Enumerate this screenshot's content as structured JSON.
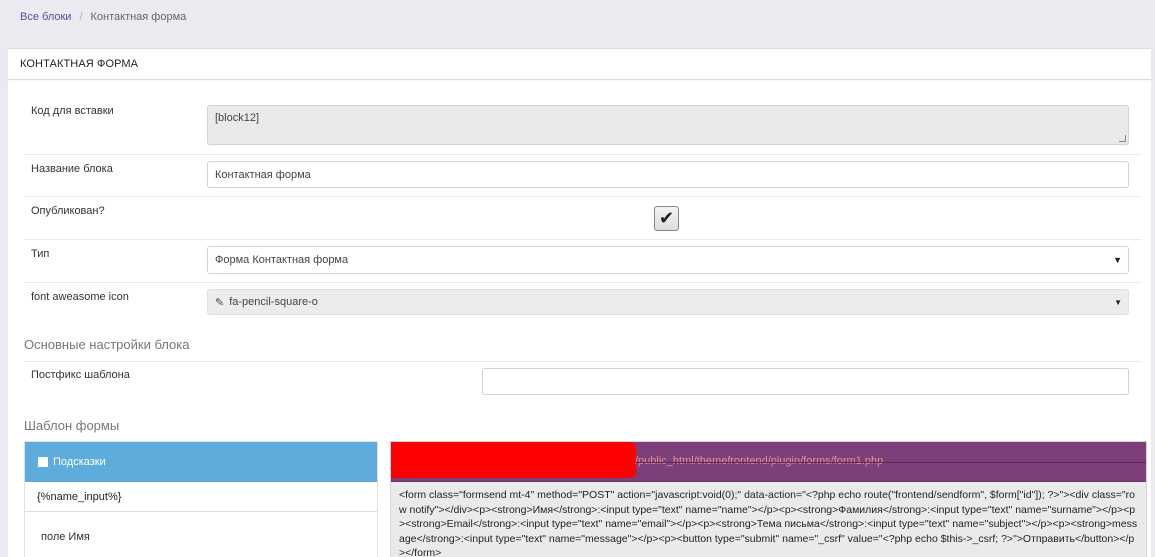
{
  "breadcrumb": {
    "root": "Все блоки",
    "separator": "/",
    "current": "Контактная форма"
  },
  "panel": {
    "title": "КОНТАКТНАЯ ФОРМА"
  },
  "fields": {
    "embed_code": {
      "label": "Код для вставки",
      "value": "[block12]"
    },
    "block_name": {
      "label": "Название блока",
      "value": "Контактная форма"
    },
    "published": {
      "label": "Опубликован?",
      "checked": true
    },
    "type": {
      "label": "Тип",
      "value": "Форма Контактная форма"
    },
    "icon": {
      "label": "font aweasome icon",
      "value": "fa-pencil-square-o",
      "icon": "pencil-square-icon"
    }
  },
  "sections": {
    "main_settings": "Основные настройки блока",
    "form_template": "Шаблон формы"
  },
  "postfix": {
    "label": "Постфикс шаблона",
    "value": ""
  },
  "hints": {
    "title": "Подсказки",
    "items": [
      "{%name_input%}",
      "поле Имя"
    ]
  },
  "code": {
    "path": "/public_html/themefrontend/plugin/forms/form1.php",
    "content": "<form class=\"formsend mt-4\" method=\"POST\" action=\"javascript:void(0);\" data-action=\"<?php echo route(\"frontend/sendform\", $form[\"id\"]); ?>\"><div class=\"row notify\"></div><p><strong>Имя</strong>:<input type=\"text\" name=\"name\"></p><p><strong>Фамилия</strong>:<input type=\"text\" name=\"surname\"></p><p><strong>Email</strong>:<input type=\"text\" name=\"email\"></p><p><strong>Тема письма</strong>:<input type=\"text\" name=\"subject\"></p><p><strong>message</strong>:<input type=\"text\" name=\"message\"></p><p><button type=\"submit\" name=\"_csrf\" value=\"<?php echo $this->_csrf; ?>\">Отправить</button></p></form>"
  },
  "colors": {
    "hints_header": "#5eacdb",
    "code_header": "#7d3f7a",
    "redaction": "#ff0000",
    "link": "#5a4ba8"
  }
}
